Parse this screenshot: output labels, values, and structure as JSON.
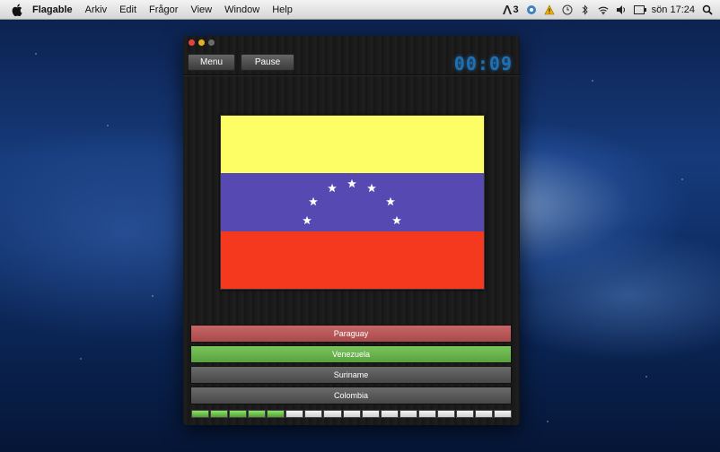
{
  "menubar": {
    "app_name": "Flagable",
    "items": [
      "Arkiv",
      "Edit",
      "Frågor",
      "View",
      "Window",
      "Help"
    ],
    "status": {
      "adobe_count": "3",
      "clock": "sön 17:24"
    }
  },
  "window": {
    "buttons": {
      "menu": "Menu",
      "pause": "Pause"
    },
    "timer": "00:09",
    "flag": {
      "colors": {
        "top": "#fdfd66",
        "middle": "#5649b1",
        "bottom": "#f4391f",
        "stars": "#ffffff"
      }
    },
    "answers": [
      {
        "label": "Paraguay",
        "state": "wrong"
      },
      {
        "label": "Venezuela",
        "state": "right"
      },
      {
        "label": "Suriname",
        "state": "neutral"
      },
      {
        "label": "Colombia",
        "state": "neutral"
      }
    ],
    "progress": {
      "completed": 5,
      "total": 17
    }
  }
}
